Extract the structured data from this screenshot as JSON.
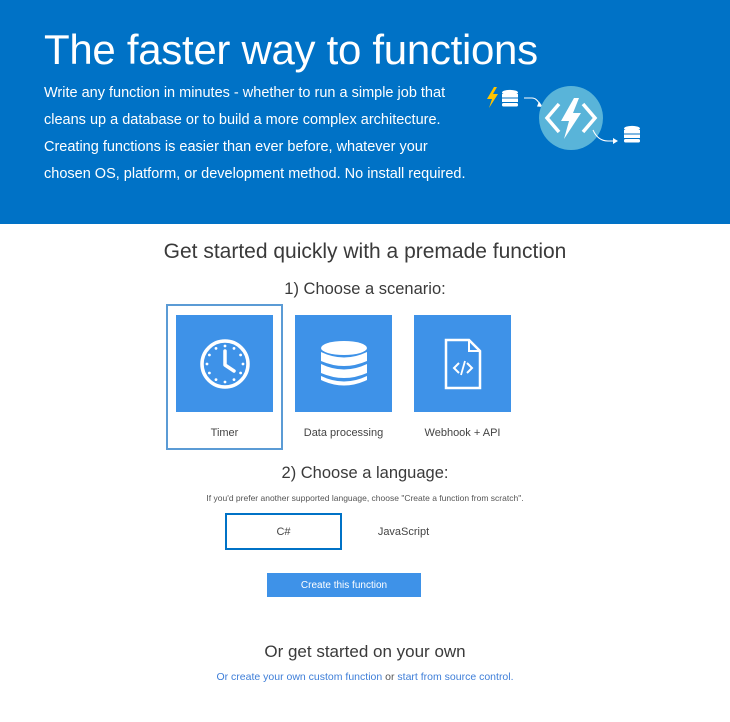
{
  "hero": {
    "title": "The faster way to functions",
    "description_lines": [
      "Write any function in minutes - whether to run a simple job that",
      "cleans up a database or to build a more complex architecture.",
      "Creating functions is easier than ever before, whatever your",
      "chosen OS, platform, or development method. No install required."
    ]
  },
  "quickstart": {
    "heading": "Get started quickly with a premade function",
    "scenario_heading": "1) Choose a scenario:",
    "scenarios": [
      {
        "label": "Timer",
        "icon": "clock-icon",
        "selected": true
      },
      {
        "label": "Data processing",
        "icon": "database-icon",
        "selected": false
      },
      {
        "label": "Webhook + API",
        "icon": "code-document-icon",
        "selected": false
      }
    ],
    "language_heading": "2) Choose a language:",
    "language_hint": "If you'd prefer another supported language, choose \"Create a function from scratch\".",
    "languages": [
      {
        "label": "C#",
        "selected": true
      },
      {
        "label": "JavaScript",
        "selected": false
      }
    ],
    "create_button": "Create this function"
  },
  "own": {
    "heading": "Or get started on your own",
    "prefix": "Or",
    "custom_link": "create your own custom function",
    "middle": "or",
    "source_link": "start from source control",
    "suffix": "."
  },
  "colors": {
    "hero_bg": "#0072c6",
    "tile_bg": "#3e92e8",
    "link": "#3e7ed8",
    "lightning": "#ffc400"
  }
}
